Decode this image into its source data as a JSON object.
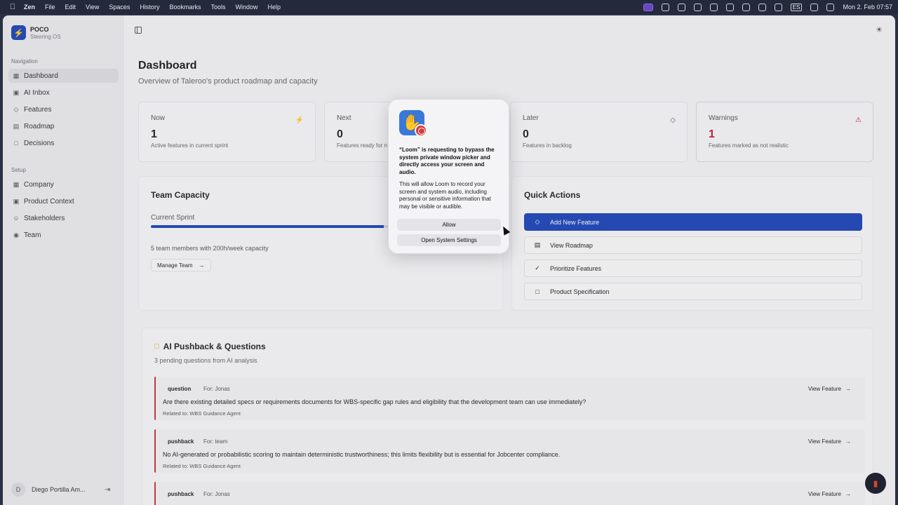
{
  "menubar": {
    "app": "Zen",
    "menus": [
      "File",
      "Edit",
      "View",
      "Spaces",
      "History",
      "Bookmarks",
      "Tools",
      "Window",
      "Help"
    ],
    "input_lang": "ES",
    "clock": "Mon 2. Feb  07:57"
  },
  "brand": {
    "name": "POCO",
    "subtitle": "Steering OS"
  },
  "sidebar": {
    "nav_label": "Navigation",
    "nav_items": [
      {
        "label": "Dashboard",
        "icon": "grid-icon"
      },
      {
        "label": "AI Inbox",
        "icon": "inbox-icon"
      },
      {
        "label": "Features",
        "icon": "layers-icon"
      },
      {
        "label": "Roadmap",
        "icon": "map-icon"
      },
      {
        "label": "Decisions",
        "icon": "document-icon"
      }
    ],
    "setup_label": "Setup",
    "setup_items": [
      {
        "label": "Company",
        "icon": "building-icon"
      },
      {
        "label": "Product Context",
        "icon": "box-icon"
      },
      {
        "label": "Stakeholders",
        "icon": "users-icon"
      },
      {
        "label": "Team",
        "icon": "team-icon"
      }
    ],
    "user": {
      "initial": "D",
      "name": "Diego Portilla Am..."
    }
  },
  "page": {
    "title": "Dashboard",
    "subtitle": "Overview of Taleroo's product roadmap and capacity"
  },
  "stats": [
    {
      "label": "Now",
      "value": "1",
      "desc": "Active features in current sprint"
    },
    {
      "label": "Next",
      "value": "0",
      "desc": "Features ready for n"
    },
    {
      "label": "Later",
      "value": "0",
      "desc": "Features in backlog"
    },
    {
      "label": "Warnings",
      "value": "1",
      "desc": "Features marked as not realistic"
    }
  ],
  "team_capacity": {
    "title": "Team Capacity",
    "sprint_label": "Current Sprint",
    "progress": 0.68,
    "summary": "5 team members with 200h/week capacity",
    "manage_label": "Manage Team"
  },
  "quick_actions": {
    "title": "Quick Actions",
    "items": [
      "Add New Feature",
      "View Roadmap",
      "Prioritize Features",
      "Product Specification"
    ]
  },
  "ai_pushback": {
    "title": "AI Pushback & Questions",
    "subtitle": "3 pending questions from AI analysis",
    "view_label": "View Feature",
    "items": [
      {
        "type": "question",
        "for": "For: Jonas",
        "text": "Are there existing detailed specs or requirements documents for WBS-specific gap rules and eligibility that the development team can use immediately?",
        "related": "Related to: WBS Guidance Agent"
      },
      {
        "type": "pushback",
        "for": "For: team",
        "text": "No AI-generated or probabilistic scoring to maintain deterministic trustworthiness; this limits flexibility but is essential for Jobcenter compliance.",
        "related": "Related to: WBS Guidance Agent"
      },
      {
        "type": "pushback",
        "for": "For: Jonas",
        "text": "",
        "related": ""
      }
    ]
  },
  "dialog": {
    "title": "“Loom” is requesting to bypass the system private window picker and directly access your screen and audio.",
    "body": "This will allow Loom to record your screen and system audio, including personal or sensitive information that may be visible or audible.",
    "allow_label": "Allow",
    "settings_label": "Open System Settings"
  },
  "colors": {
    "accent": "#1c45b8",
    "warning": "#c0182a",
    "pushback_border": "#c8303e"
  }
}
